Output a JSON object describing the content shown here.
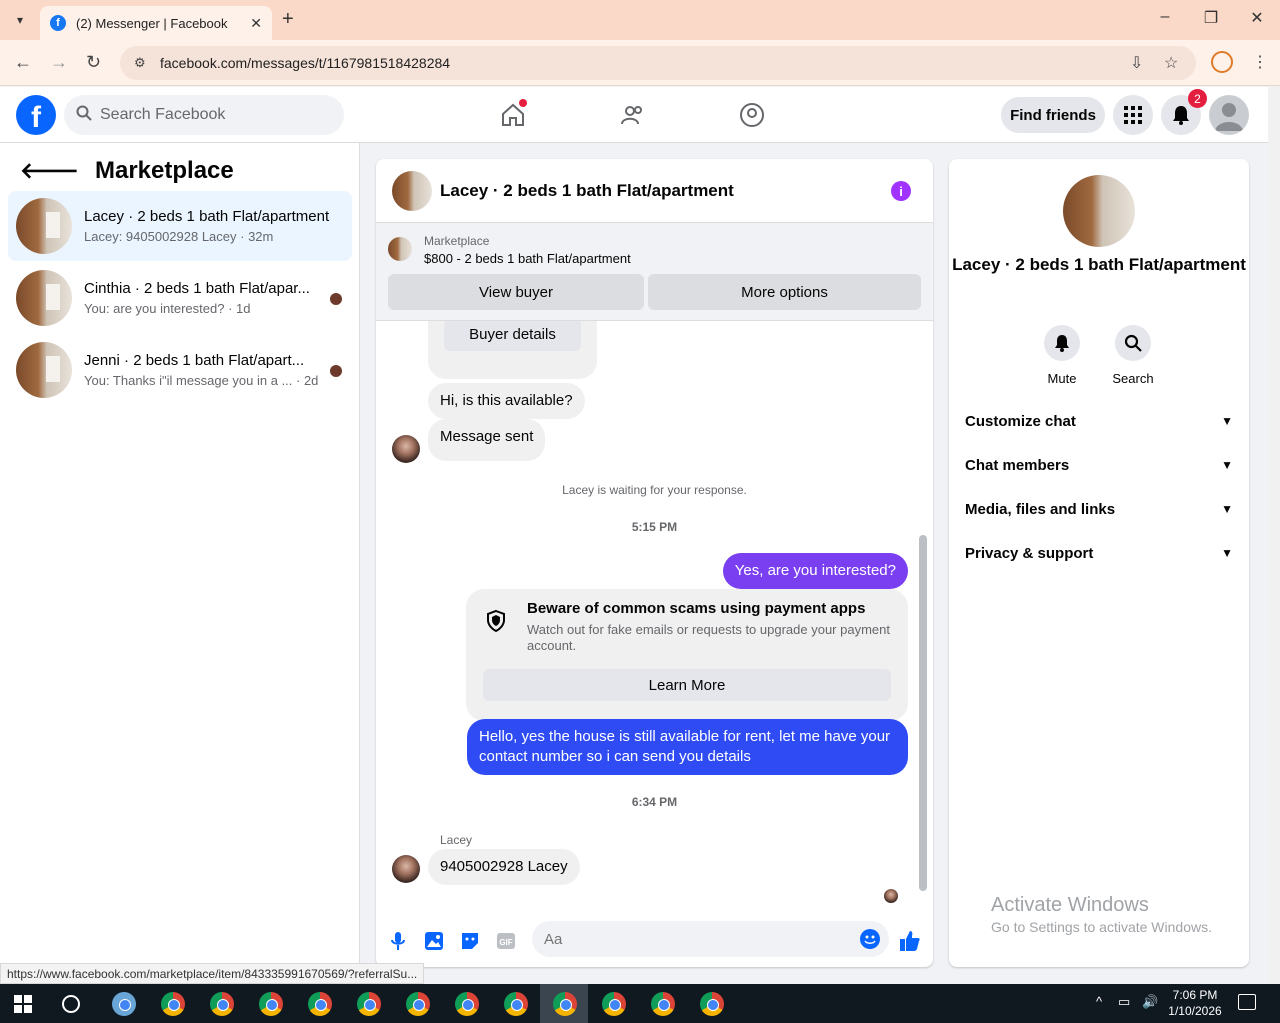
{
  "browser": {
    "tab_title": "(2) Messenger | Facebook",
    "url": "facebook.com/messages/t/1167981518428284",
    "status_url": "https://www.facebook.com/marketplace/item/843335991670569/?referralSu..."
  },
  "fb_header": {
    "search_placeholder": "Search Facebook",
    "find_friends": "Find friends",
    "notification_count": "2"
  },
  "left": {
    "title": "Marketplace",
    "conversations": [
      {
        "title": "Lacey · 2 beds 1 bath Flat/apartment",
        "subtitle": "Lacey: 9405002928 Lacey · 32m"
      },
      {
        "title": "Cinthia · 2 beds 1 bath Flat/apar...",
        "subtitle": "You: are you interested? · 1d"
      },
      {
        "title": "Jenni · 2 beds 1 bath Flat/apart...",
        "subtitle": "You: Thanks i\"il message you in a ...   · 2d"
      }
    ]
  },
  "chat": {
    "title": "Lacey · 2 beds 1 bath Flat/apartment",
    "banner_label": "Marketplace",
    "banner_listing": "$800 - 2 beds 1 bath Flat/apartment",
    "view_buyer": "View buyer",
    "more_options": "More options",
    "buyer_details": "Buyer details",
    "msg_available": "Hi, is this available?",
    "msg_sent": "Message sent",
    "waiting": "Lacey is waiting for your response.",
    "time1": "5:15 PM",
    "msg_interested": "Yes, are you interested?",
    "scam_title": "Beware of common scams using payment apps",
    "scam_desc": "Watch out for fake emails or requests to upgrade your payment account.",
    "learn_more": "Learn More",
    "msg_house": "Hello, yes the house is still available for rent, let me have your contact number so i can send you details",
    "time2": "6:34 PM",
    "sender_name": "Lacey",
    "msg_number": "9405002928 Lacey",
    "composer_placeholder": "Aa"
  },
  "right": {
    "name": "Lacey · 2 beds 1 bath Flat/apartment",
    "mute": "Mute",
    "search": "Search",
    "sections": [
      "Customize chat",
      "Chat members",
      "Media, files and links",
      "Privacy & support"
    ]
  },
  "watermark": {
    "line1": "Activate Windows",
    "line2": "Go to Settings to activate Windows."
  },
  "taskbar": {
    "time": "7:06 PM",
    "date": "1/10/2026"
  },
  "colors": {
    "fb_blue": "#0866ff",
    "bubble_purple": "#7b3ff2",
    "bubble_blue": "#2f4cf4",
    "tab_bar": "#fbd9c8"
  }
}
